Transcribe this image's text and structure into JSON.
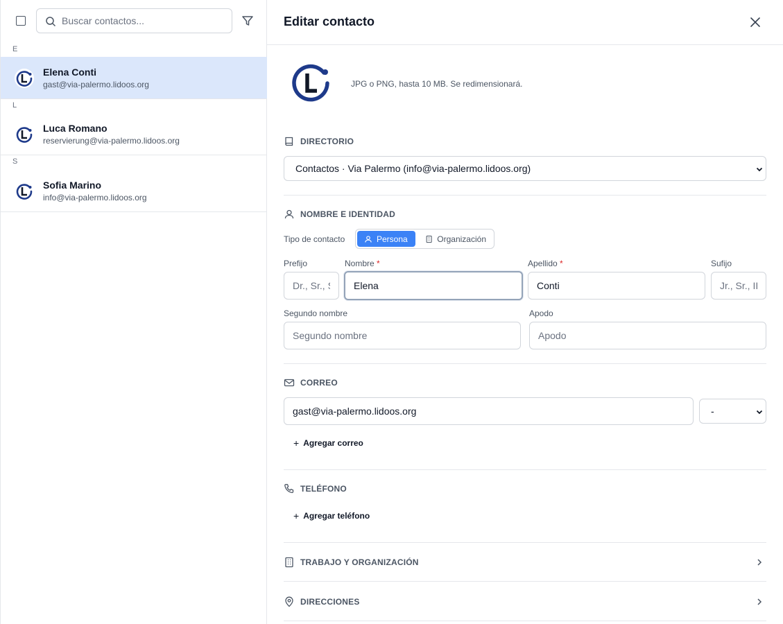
{
  "sidebar": {
    "search_placeholder": "Buscar contactos...",
    "groups": [
      {
        "letter": "E",
        "contacts": [
          {
            "name": "Elena Conti",
            "email": "gast@via-palermo.lidoos.org",
            "active": true
          }
        ]
      },
      {
        "letter": "L",
        "contacts": [
          {
            "name": "Luca Romano",
            "email": "reservierung@via-palermo.lidoos.org",
            "active": false
          }
        ]
      },
      {
        "letter": "S",
        "contacts": [
          {
            "name": "Sofia Marino",
            "email": "info@via-palermo.lidoos.org",
            "active": false
          }
        ]
      }
    ]
  },
  "editor": {
    "title": "Editar contacto",
    "avatar_hint": "JPG o PNG, hasta 10 MB. Se redimensionará.",
    "directory": {
      "title": "DIRECTORIO",
      "selected": "Contactos · Via Palermo (info@via-palermo.lidoos.org)"
    },
    "identity": {
      "title": "NOMBRE E IDENTIDAD",
      "type_label": "Tipo de contacto",
      "type_person": "Persona",
      "type_org": "Organización",
      "prefix_label": "Prefijo",
      "prefix_placeholder": "Dr., Sr., Sra.",
      "first_label": "Nombre",
      "first_value": "Elena",
      "last_label": "Apellido",
      "last_value": "Conti",
      "suffix_label": "Sufijo",
      "suffix_placeholder": "Jr., Sr., III",
      "middle_label": "Segundo nombre",
      "middle_placeholder": "Segundo nombre",
      "nick_label": "Apodo",
      "nick_placeholder": "Apodo",
      "required_mark": "*"
    },
    "email": {
      "title": "CORREO",
      "value": "gast@via-palermo.lidoos.org",
      "type_value": "-",
      "add_label": "Agregar correo"
    },
    "phone": {
      "title": "TELÉFONO",
      "add_label": "Agregar teléfono"
    },
    "work": {
      "title": "TRABAJO Y ORGANIZACIÓN"
    },
    "addresses": {
      "title": "DIRECCIONES"
    },
    "colors": {
      "accent": "#3b82f6",
      "selected_row": "#dbe7fb",
      "logo_blue": "#1e3a8a"
    }
  }
}
